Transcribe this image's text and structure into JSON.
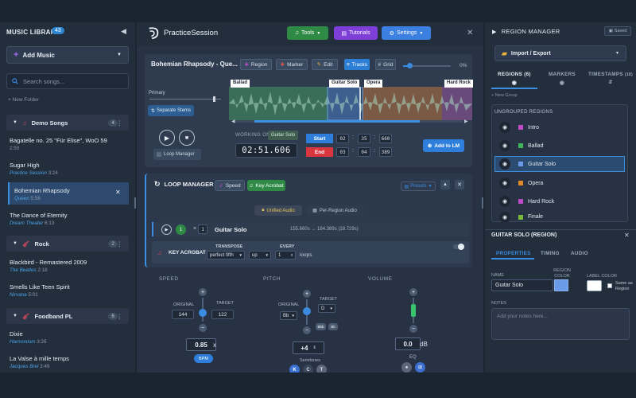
{
  "library": {
    "title": "MUSIC LIBRARY",
    "count": "43",
    "add_music": "Add Music",
    "search_placeholder": "Search songs...",
    "new_folder": "+ New Folder",
    "folders": [
      {
        "name": "Demo Songs",
        "count": "4"
      },
      {
        "name": "Rock",
        "count": "2"
      },
      {
        "name": "Foodband PL",
        "count": "6"
      }
    ],
    "songs": [
      {
        "title": "Bagatelle no. 25 \"Für Elise\", WoO 59",
        "artist": "",
        "duration": "2:50"
      },
      {
        "title": "Sugar High",
        "artist": "Practice Session",
        "duration": "3:24"
      },
      {
        "title": "Bohemian Rhapsody",
        "artist": "Queen",
        "duration": "5:56"
      },
      {
        "title": "The Dance of Eternity",
        "artist": "Dream Theater",
        "duration": "6:13"
      },
      {
        "title": "Blackbird - Remastered 2009",
        "artist": "The Beatles",
        "duration": "2:18"
      },
      {
        "title": "Smells Like Teen Spirit",
        "artist": "Nirvana",
        "duration": "5:01"
      },
      {
        "title": "Dixie",
        "artist": "Harmonium",
        "duration": "3:26"
      },
      {
        "title": "La Valse à mille temps",
        "artist": "Jacques Brel",
        "duration": "3:49"
      }
    ]
  },
  "header": {
    "app_name": "PracticeSession",
    "tools": "Tools",
    "tutorials": "Tutorials",
    "settings": "Settings"
  },
  "player": {
    "song_title": "Bohemian Rhapsody - Que...",
    "toolbar": {
      "region": "Region",
      "marker": "Marker",
      "edit": "Edit",
      "tracks": "Tracks",
      "grid": "Grid"
    },
    "volume_pct": "0%",
    "region_labels": [
      "Ballad",
      "Guitar Solo",
      "Opera",
      "Hard Rock"
    ],
    "primary_label": "Primary",
    "separate_stems": "Separate Stems",
    "loop_manager": "Loop Manager",
    "working_on_label": "WORKING ON:",
    "working_on": "Guitar Solo",
    "time": "02:51.606",
    "start_label": "Start",
    "end_label": "End",
    "start": [
      "02",
      "35",
      "660"
    ],
    "end": [
      "03",
      "04",
      "389"
    ],
    "add_to_lm": "Add to LM"
  },
  "loopmgr": {
    "title": "LOOP MANAGER",
    "speed": "Speed",
    "key_acrobat": "Key Acrobat",
    "presets": "Presets",
    "unified": "Unified Audio",
    "per_region": "Per-Region Audio",
    "loop_count": "1",
    "times_label": "×",
    "times_value": "1",
    "loop_name": "Guitar Solo",
    "loop_range": "155.660s → 184.389s (28.729s)",
    "ka_title": "KEY ACROBAT",
    "transpose_label": "TRANSPOSE",
    "every_label": "EVERY",
    "interval": "perfect fifth",
    "direction": "up",
    "every_value": "1",
    "loops_label": "loops"
  },
  "controls": {
    "speed_label": "SPEED",
    "pitch_label": "PITCH",
    "volume_label": "VOLUME",
    "original_label": "ORIGINAL",
    "target_label": "TARGET",
    "speed_original": "144",
    "speed_target": "122",
    "speed_value": "0.85",
    "speed_unit": "x",
    "bpm": "BPM",
    "pitch_original": "Bb",
    "pitch_target": "D",
    "pitch_flat": "Bbb",
    "pitch_flat2": "Bb",
    "pitch_value": "+4",
    "semitones_label": "Semitones",
    "pitch_keys": [
      "K",
      "C",
      "T"
    ],
    "volume_value": "0.0",
    "volume_unit": "dB",
    "eq_label": "EQ",
    "volume_level": 0.5
  },
  "regions": {
    "title": "REGION MANAGER",
    "saved": "Saved",
    "import_export": "Import / Export",
    "tabs": [
      {
        "label": "REGIONS",
        "count": "(6)"
      },
      {
        "label": "MARKERS",
        "count": ""
      },
      {
        "label": "TIMESTAMPS",
        "count": "(18)"
      }
    ],
    "new_group": "+ New Group",
    "ungrouped": "UNGROUPED REGIONS",
    "items": [
      {
        "name": "Intro",
        "color": "#c04bc8"
      },
      {
        "name": "Ballad",
        "color": "#3fb35b"
      },
      {
        "name": "Guitar Solo",
        "color": "#6a9be8"
      },
      {
        "name": "Opera",
        "color": "#e0892a"
      },
      {
        "name": "Hard Rock",
        "color": "#c04bc8"
      },
      {
        "name": "Finale",
        "color": "#79b83a"
      }
    ],
    "detail_title": "GUITAR SOLO (REGION)",
    "detail_tabs": [
      "PROPERTIES",
      "TIMING",
      "AUDIO"
    ],
    "name_label": "NAME",
    "name_value": "Guitar Solo",
    "region_color_label": "REGION COLOR",
    "label_color_label": "LABEL COLOR",
    "same_as_region": "Same as Region",
    "notes_label": "NOTES",
    "notes_placeholder": "Add your notes here..."
  }
}
